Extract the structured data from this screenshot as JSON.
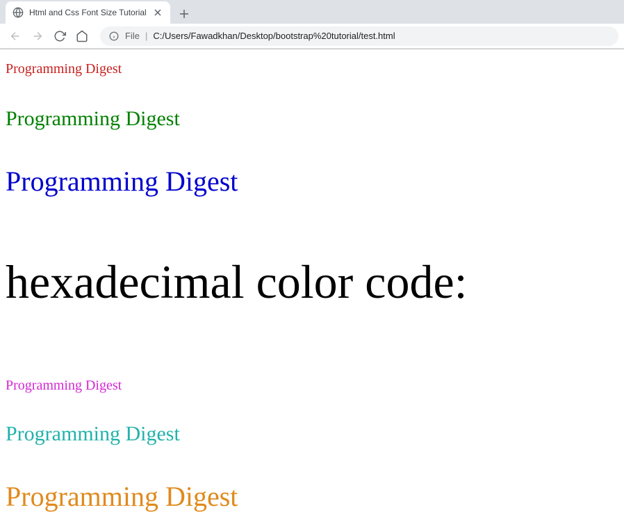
{
  "browser": {
    "tab_title": "Html and Css Font Size Tutorial",
    "url_prefix": "File",
    "url": "C:/Users/Fawadkhan/Desktop/bootstrap%20tutorial/test.html"
  },
  "content": {
    "line1": "Programming Digest",
    "line2": "Programming Digest",
    "line3": "Programming Digest",
    "heading": "hexadecimal color code:",
    "line4": "Programming Digest",
    "line5": "Programming Digest",
    "line6": "Programming Digest"
  }
}
